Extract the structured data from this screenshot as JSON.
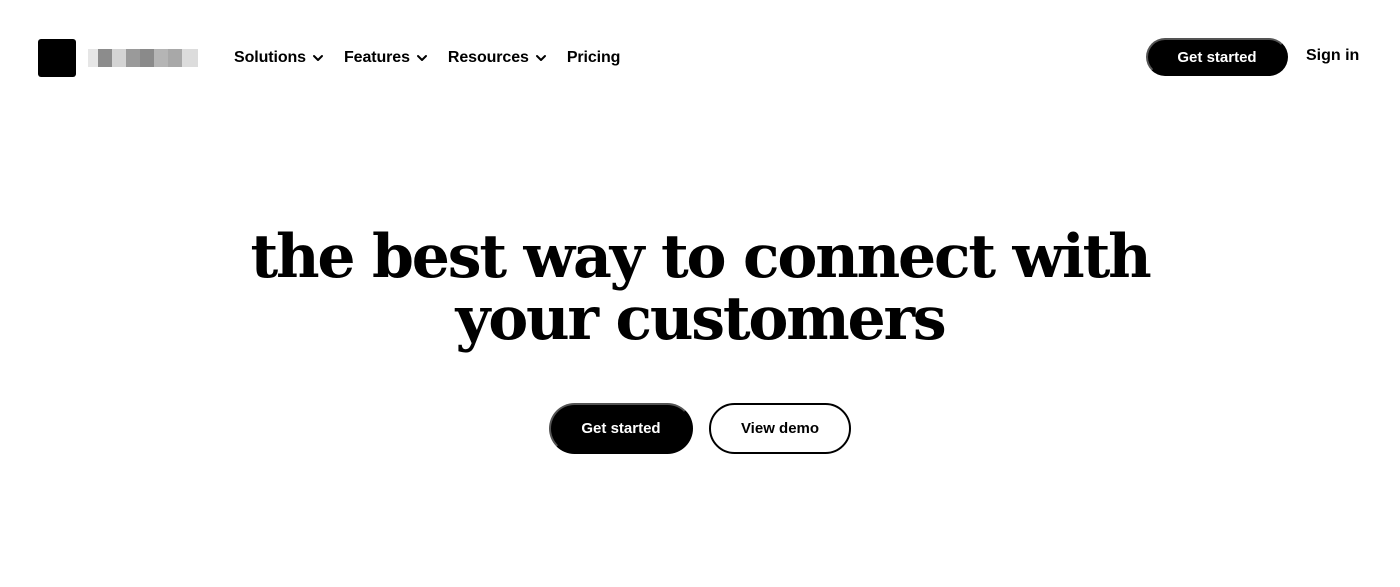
{
  "nav": {
    "links": [
      {
        "label": "Solutions",
        "has_dropdown": true
      },
      {
        "label": "Features",
        "has_dropdown": true
      },
      {
        "label": "Resources",
        "has_dropdown": true
      },
      {
        "label": "Pricing",
        "has_dropdown": false
      }
    ],
    "cta_label": "Get started",
    "signin_label": "Sign in"
  },
  "hero": {
    "title_line1": "the best way to connect with",
    "title_line2": "your customers",
    "primary_label": "Get started",
    "secondary_label": "View demo"
  },
  "colors": {
    "text": "#000000",
    "background": "#ffffff",
    "button_dark": "#000000",
    "button_text": "#ffffff"
  },
  "icons": {
    "dropdown": "chevron-down-icon"
  }
}
